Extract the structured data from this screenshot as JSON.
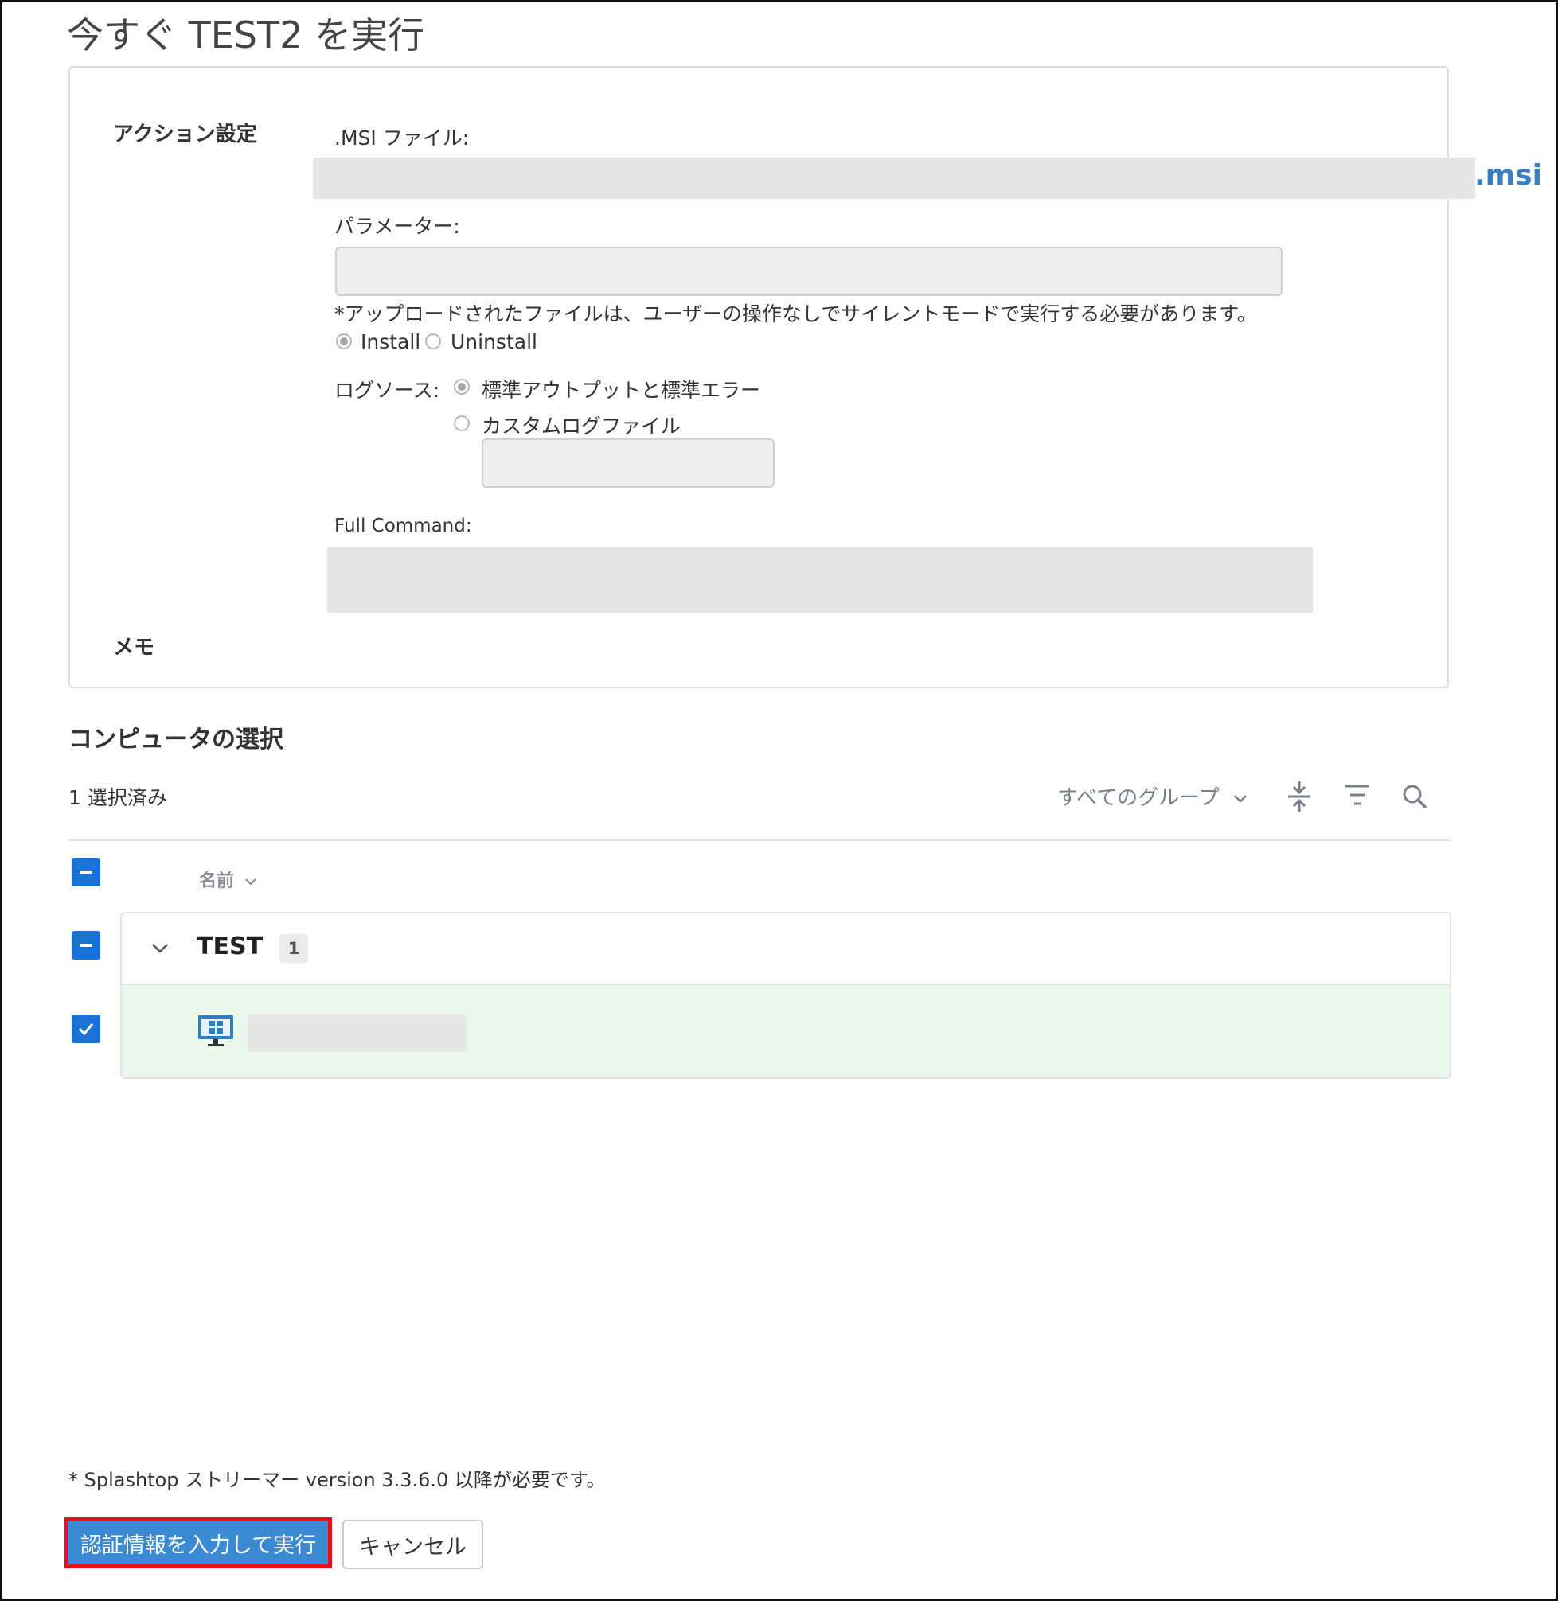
{
  "page": {
    "title": "今すぐ TEST2 を実行"
  },
  "action_settings": {
    "section_label": "アクション設定",
    "msi_label": ".MSI ファイル:",
    "msi_ext": ".msi",
    "params_label": "パラメーター:",
    "params_value": "",
    "silent_note": "*アップロードされたファイルは、ユーザーの操作なしでサイレントモードで実行する必要があります。",
    "mode_options": [
      {
        "label": "Install",
        "checked": true
      },
      {
        "label": "Uninstall",
        "checked": false
      }
    ],
    "log_source_label": "ログソース:",
    "log_options": [
      {
        "label": "標準アウトプットと標準エラー",
        "checked": true
      },
      {
        "label": "カスタムログファイル",
        "checked": false
      }
    ],
    "custom_log_value": "",
    "full_command_label": "Full Command:",
    "memo_label": "メモ"
  },
  "computer_selection": {
    "title": "コンピュータの選択",
    "selected_count": "1 選択済み",
    "group_filter": "すべてのグループ",
    "name_header": "名前",
    "groups": [
      {
        "name": "TEST",
        "count": "1"
      }
    ]
  },
  "footer": {
    "requirement_note": "* Splashtop ストリーマー version 3.3.6.0 以降が必要です。",
    "run_button": "認証情報を入力して実行",
    "cancel_button": "キャンセル"
  },
  "colors": {
    "accent_blue": "#1a73d4",
    "button_blue": "#3c8ad3",
    "highlight_red": "#e1121e",
    "selected_row": "#eaf8ee"
  }
}
